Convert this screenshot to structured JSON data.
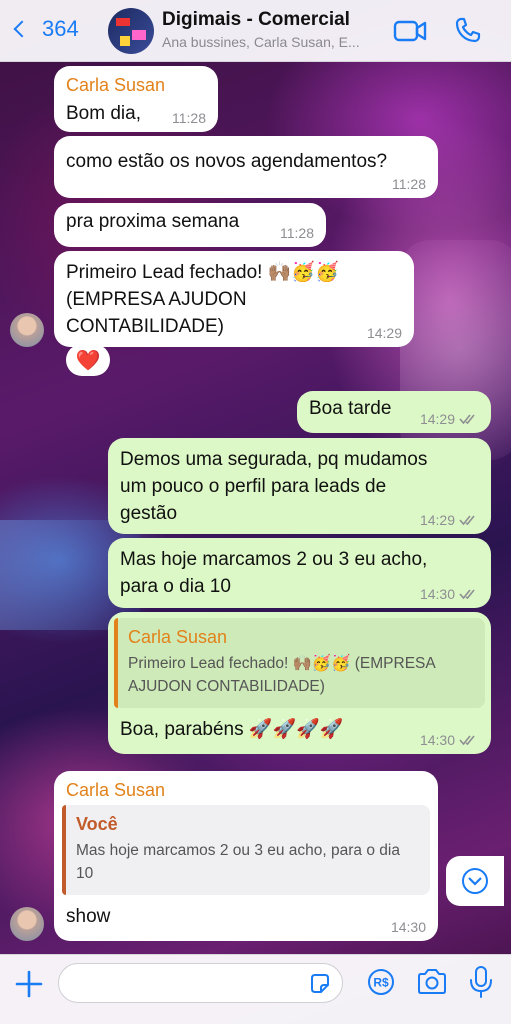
{
  "header": {
    "back_count": "364",
    "title": "Digimais - Comercial",
    "subtitle": "Ana bussines, Carla Susan, E..."
  },
  "messages": [
    {
      "id": "m1",
      "direction": "incoming",
      "sender": "Carla Susan",
      "text": "Bom dia,",
      "time": "11:28"
    },
    {
      "id": "m2",
      "direction": "incoming",
      "text": "como estão os novos agendamentos?",
      "time": "11:28"
    },
    {
      "id": "m3",
      "direction": "incoming",
      "text": "pra proxima semana",
      "time": "11:28"
    },
    {
      "id": "m4",
      "direction": "incoming",
      "text_line1": "Primeiro Lead fechado! 🙌🏽🥳🥳",
      "text_line2": "(EMPRESA AJUDON",
      "text_line3": "CONTABILIDADE)",
      "time": "14:29",
      "reaction": "❤️"
    },
    {
      "id": "m5",
      "direction": "outgoing",
      "text": "Boa tarde",
      "time": "14:29"
    },
    {
      "id": "m6",
      "direction": "outgoing",
      "text_line1": "Demos uma segurada, pq mudamos",
      "text_line2": "um pouco o perfil para leads de",
      "text_line3": "gestão",
      "time": "14:29"
    },
    {
      "id": "m7",
      "direction": "outgoing",
      "text_line1": "Mas hoje marcamos 2 ou 3 eu acho,",
      "text_line2": "para o dia 10",
      "time": "14:30"
    },
    {
      "id": "m8",
      "direction": "outgoing",
      "quote_name": "Carla Susan",
      "quote_line1": "Primeiro Lead fechado! 🙌🏽🥳🥳  (EMPRESA",
      "quote_line2": "AJUDON CONTABILIDADE)",
      "text": "Boa, parabéns 🚀🚀🚀🚀",
      "time": "14:30"
    },
    {
      "id": "m9",
      "direction": "incoming",
      "sender": "Carla Susan",
      "quote_name": "Você",
      "quote_line1": "Mas hoje marcamos 2 ou 3 eu acho, para o dia",
      "quote_line2": "10",
      "text": "show",
      "time": "14:30"
    }
  ],
  "composer": {
    "placeholder": ""
  },
  "colors": {
    "accent": "#1a7cf5",
    "outgoing_bubble": "#dcf8c6",
    "incoming_bubble": "#ffffff",
    "sender_name": "#e2821a",
    "quote_you": "#c25b2b"
  },
  "icons": [
    "back-chevron-icon",
    "video-call-icon",
    "phone-icon",
    "check-marks-icon",
    "scroll-down-icon",
    "plus-icon",
    "sticker-icon",
    "pix-icon",
    "camera-icon",
    "microphone-icon"
  ]
}
